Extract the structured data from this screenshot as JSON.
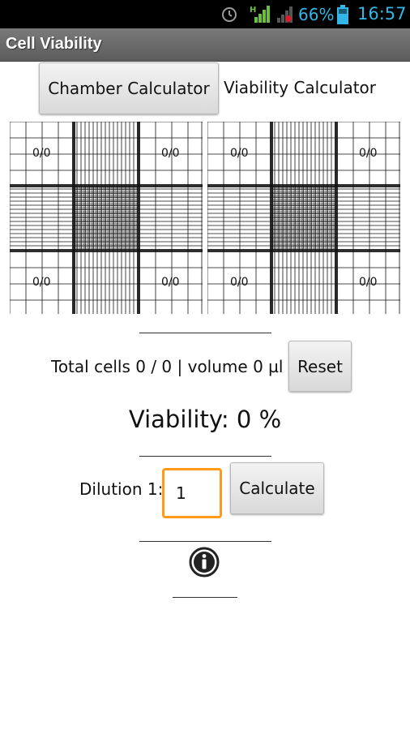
{
  "status_bar": {
    "battery_percent": "66%",
    "time": "16:57",
    "network_label": "H",
    "icons": [
      "alarm-icon",
      "signal-icon",
      "signal-icon-secondary",
      "battery-icon"
    ],
    "accent_color": "#33b5e5"
  },
  "app": {
    "title": "Cell Viability"
  },
  "tabs": {
    "chamber": "Chamber Calculator",
    "viability": "Viability Calculator"
  },
  "hemocytometer": {
    "left": {
      "top_left": "0/0",
      "top_right": "0/0",
      "bottom_left": "0/0",
      "bottom_right": "0/0"
    },
    "right": {
      "top_left": "0/0",
      "top_right": "0/0",
      "bottom_left": "0/0",
      "bottom_right": "0/0"
    }
  },
  "divider_text": {
    "long": "______________",
    "short": "_______"
  },
  "totals": {
    "text": "Total cells 0 / 0 | volume 0 µl",
    "reset_label": "Reset"
  },
  "viability": {
    "text": "Viability: 0 %"
  },
  "dilution": {
    "label": "Dilution 1:",
    "value": "1",
    "calculate_label": "Calculate"
  },
  "colors": {
    "input_focus": "#ff9a1a",
    "title_bar": "#6b6b6b"
  }
}
